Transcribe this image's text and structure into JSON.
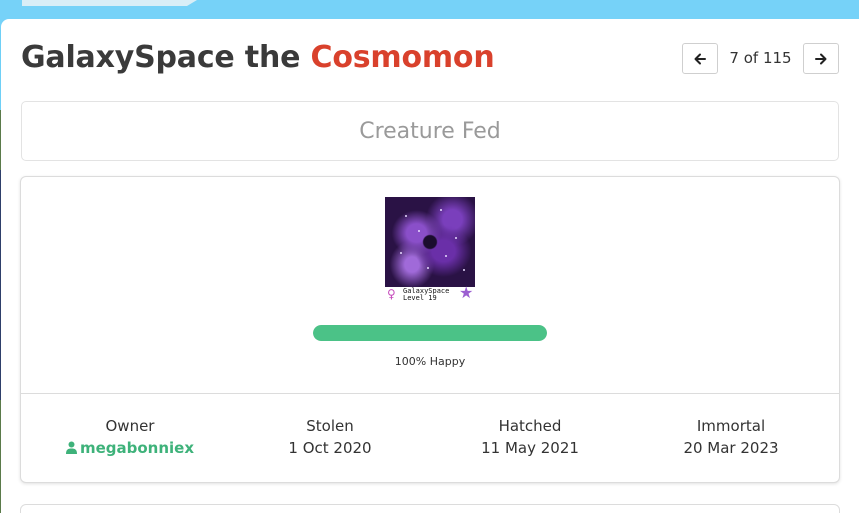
{
  "header": {
    "title_name": "GalaxySpace the ",
    "title_species": "Cosmomon"
  },
  "pager": {
    "position_text": "7 of 115",
    "prev_icon": "arrow-left-icon",
    "next_icon": "arrow-right-icon"
  },
  "status": {
    "text": "Creature Fed"
  },
  "creature": {
    "image_icon": "creature-image",
    "gender_icon": "female-icon",
    "name_tag": "GalaxySpace",
    "level_tag": "Level 19",
    "star_icon": "star-icon",
    "happiness_fraction": 1.0,
    "happiness_text": "100% Happy",
    "accent_color": "#4bc287"
  },
  "stats": {
    "owner_label": "Owner",
    "owner_value": "megabonniex",
    "stolen_label": "Stolen",
    "stolen_value": "1 Oct 2020",
    "hatched_label": "Hatched",
    "hatched_value": "11 May 2021",
    "immortal_label": "Immortal",
    "immortal_value": "20 Mar 2023"
  },
  "colors": {
    "species_accent": "#d9412c",
    "owner_link": "#3eb27a"
  }
}
